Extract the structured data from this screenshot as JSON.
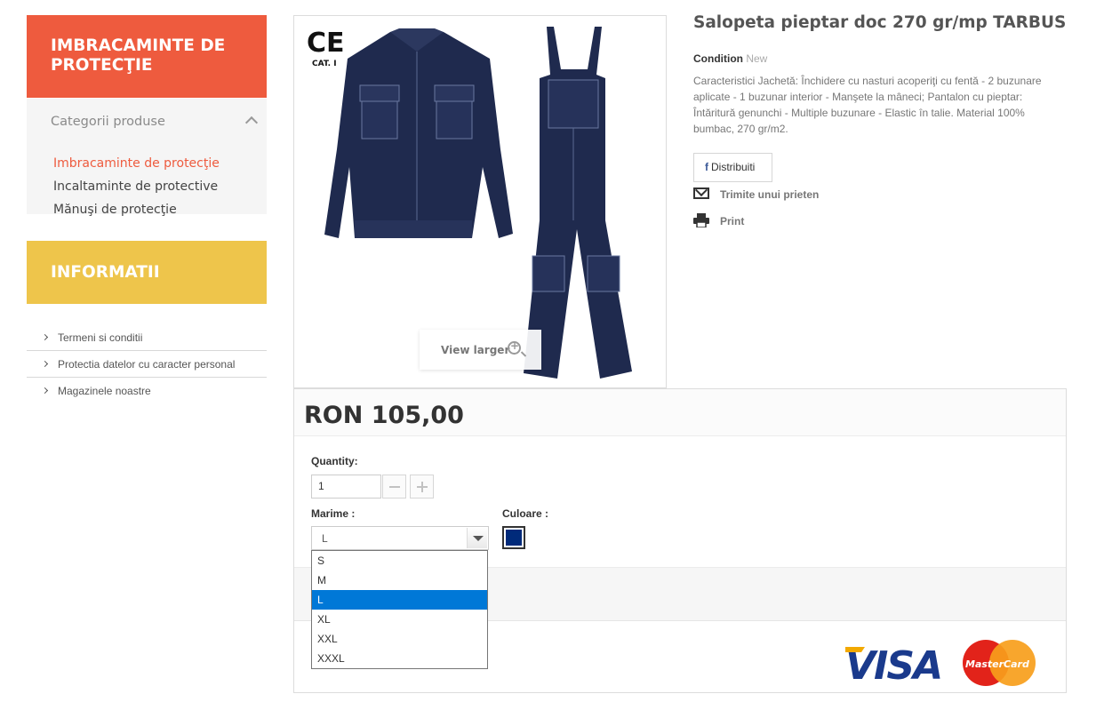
{
  "sidebar": {
    "categories_title": "IMBRACAMINTE DE PROTECŢIE",
    "categories_toggle": "Categorii produse",
    "categories": [
      {
        "label": "Imbracaminte de protecţie",
        "active": true
      },
      {
        "label": "Incaltaminte de protective",
        "active": false
      },
      {
        "label": "Mănuşi de protecţie",
        "active": false
      }
    ],
    "info_title": "INFORMATII",
    "info_links": [
      "Termeni si conditii",
      "Protectia datelor cu caracter personal",
      "Magazinele noastre"
    ]
  },
  "product": {
    "title": "Salopeta pieptar doc 270 gr/mp TARBUS",
    "condition_label": "Condition",
    "condition_value": "New",
    "description": "Caracteristici Jachetă: Închidere cu nasturi acoperiţi cu fentă - 2 buzunare aplicate - 1 buzunar interior - Manşete la mâneci; Pantalon cu pieptar: Întăritură genunchi - Multiple buzunare - Elastic în talie. Material 100% bumbac, 270 gr/m2.",
    "share_label": "Distribuiti",
    "send_friend_label": "Trimite unui prieten",
    "print_label": "Print",
    "view_larger": "View larger",
    "image_marks": {
      "ce": "CE",
      "cat": "CAT. I"
    },
    "price": "RON 105,00",
    "quantity_label": "Quantity:",
    "quantity_value": "1",
    "size_label": "Marime :",
    "size_selected": "L",
    "size_options": [
      "S",
      "M",
      "L",
      "XL",
      "XXL",
      "XXXL"
    ],
    "color_label": "Culoare :",
    "color_value": "#002a7a",
    "payment": {
      "visa": "VISA",
      "mastercard": "MasterCard"
    }
  },
  "colors": {
    "accent_orange": "#ee5b3e",
    "accent_yellow": "#eec54b",
    "dropdown_highlight": "#0078d7"
  }
}
